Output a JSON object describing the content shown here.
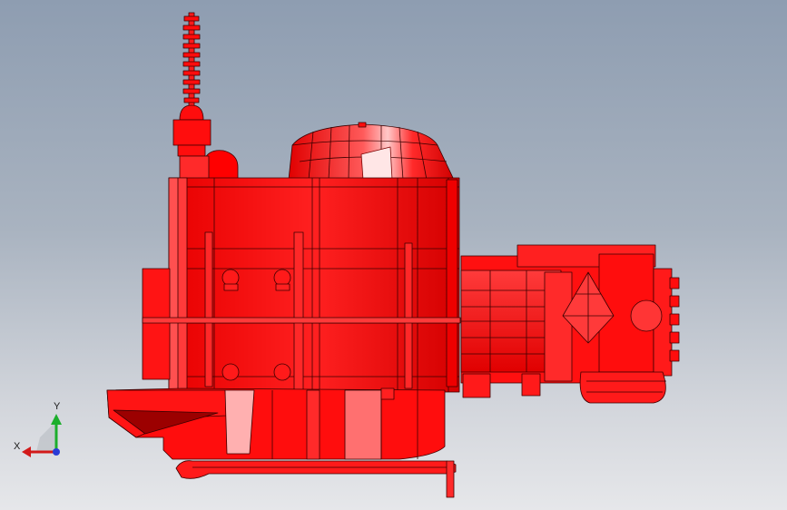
{
  "viewport": {
    "model_color": "#ff0d0d",
    "model_highlight": "#ff8a8a",
    "model_shadow": "#b80000",
    "edge_color": "#3a0000",
    "background_top": "#8e9db1",
    "background_bottom": "#e6e7ea"
  },
  "triad": {
    "x_label": "X",
    "y_label": "Y",
    "x_color": "#d21a1a",
    "y_color": "#1cae2c",
    "z_color": "#2a3bd6"
  }
}
